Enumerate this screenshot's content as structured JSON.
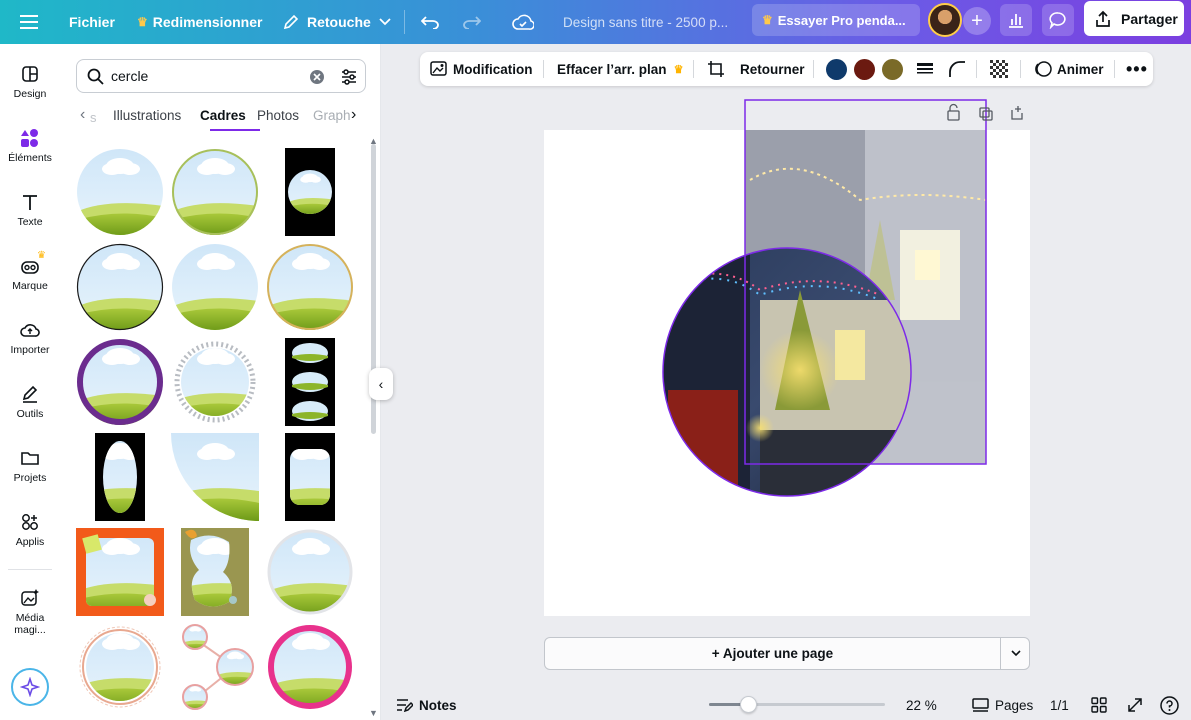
{
  "topbar": {
    "menu_icon": "hamburger-icon",
    "file": "Fichier",
    "resize": "Redimensionner",
    "retouch": "Retouche",
    "doc_title": "Design sans titre - 2500 p...",
    "trial": "Essayer Pro penda...",
    "share": "Partager"
  },
  "rail": {
    "items": [
      {
        "label": "Design",
        "icon": "layout-icon"
      },
      {
        "label": "Éléments",
        "icon": "shapes-icon"
      },
      {
        "label": "Texte",
        "icon": "text-icon"
      },
      {
        "label": "Marque",
        "icon": "brand-icon"
      },
      {
        "label": "Importer",
        "icon": "upload-cloud-icon"
      },
      {
        "label": "Outils",
        "icon": "pen-icon"
      },
      {
        "label": "Projets",
        "icon": "folder-icon"
      },
      {
        "label": "Applis",
        "icon": "apps-icon"
      },
      {
        "label": "Média magi...",
        "icon": "magic-media-icon"
      }
    ]
  },
  "panel": {
    "search_value": "cercle",
    "tabs": [
      "Illustrations",
      "Cadres",
      "Photos",
      "Graph"
    ],
    "active_tab": "Cadres"
  },
  "toolbar": {
    "edit": "Modification",
    "remove_bg": "Effacer l’arr. plan",
    "flip": "Retourner",
    "animate": "Animer",
    "colors": [
      "#0f3a6b",
      "#6b1a10",
      "#7a6a28"
    ]
  },
  "canvas": {
    "add_page": "+ Ajouter une page"
  },
  "bottom": {
    "notes": "Notes",
    "zoom": "22 %",
    "zoom_fraction": 0.22,
    "pages": "Pages",
    "page_count": "1/1"
  }
}
